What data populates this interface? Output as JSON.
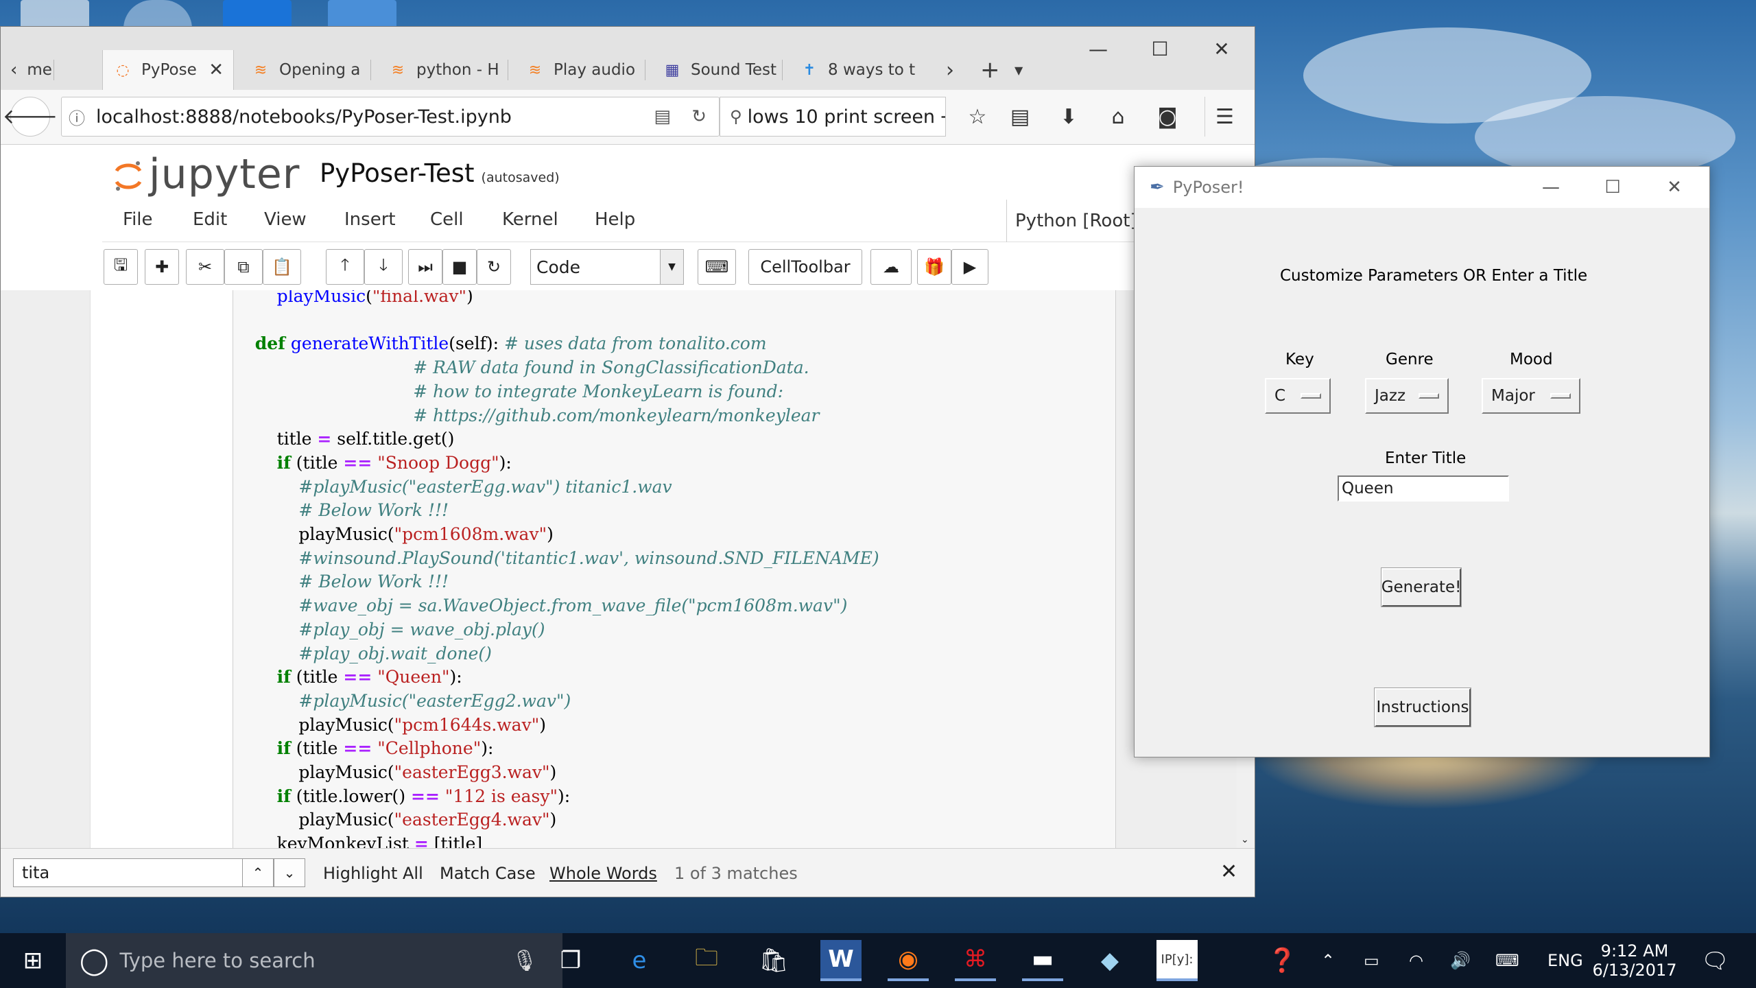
{
  "browser": {
    "tabs": [
      {
        "label": "me",
        "icon": "back-arrow-icon"
      },
      {
        "label": "PyPose",
        "icon": "jupyter-icon",
        "active": true
      },
      {
        "label": "Opening a",
        "icon": "stackoverflow-icon"
      },
      {
        "label": "python - H",
        "icon": "stackoverflow-icon"
      },
      {
        "label": "Play audio",
        "icon": "stackoverflow-icon"
      },
      {
        "label": "Sound Test",
        "icon": "page-icon"
      },
      {
        "label": "8 ways to t",
        "icon": "pin-icon"
      }
    ],
    "url": "localhost:8888/notebooks/PyPoser-Test.ipynb",
    "search_text": "lows 10 print screen"
  },
  "jupyter": {
    "logo": "jupyter",
    "notebook_title": "PyPoser-Test",
    "save_status": "(autosaved)",
    "menu": [
      "File",
      "Edit",
      "View",
      "Insert",
      "Cell",
      "Kernel",
      "Help"
    ],
    "kernel": "Python [Root]",
    "cell_type": "Code",
    "celltoolbar_label": "CellToolbar"
  },
  "code_lines": [
    [
      [
        "",
        "        "
      ],
      [
        "fn",
        "playMusic"
      ],
      [
        "",
        "("
      ],
      [
        "st",
        "\"final.wav\""
      ],
      [
        "",
        ")"
      ]
    ],
    [],
    [
      [
        "",
        "    "
      ],
      [
        "kw",
        "def"
      ],
      [
        "",
        " "
      ],
      [
        "fn",
        "generateWithTitle"
      ],
      [
        "",
        "(self): "
      ],
      [
        "cm",
        "# uses data from tonalito.com"
      ]
    ],
    [
      [
        "",
        "                                 "
      ],
      [
        "cm",
        "# RAW data found in SongClassificationData."
      ]
    ],
    [
      [
        "",
        "                                 "
      ],
      [
        "cm",
        "# how to integrate MonkeyLearn is found:"
      ]
    ],
    [
      [
        "",
        "                                 "
      ],
      [
        "cm",
        "# https://github.com/monkeylearn/monkeylear"
      ]
    ],
    [
      [
        "",
        "        title "
      ],
      [
        "op",
        "="
      ],
      [
        "",
        " self.title.get()"
      ]
    ],
    [
      [
        "",
        "        "
      ],
      [
        "kw",
        "if"
      ],
      [
        "",
        " (title "
      ],
      [
        "op",
        "=="
      ],
      [
        "",
        " "
      ],
      [
        "st",
        "\"Snoop Dogg\""
      ],
      [
        "",
        "):"
      ]
    ],
    [
      [
        "",
        "            "
      ],
      [
        "cm",
        "#playMusic(\"easterEgg.wav\") titanic1.wav"
      ]
    ],
    [
      [
        "",
        "            "
      ],
      [
        "cm",
        "# Below Work !!!"
      ]
    ],
    [
      [
        "",
        "            playMusic("
      ],
      [
        "st",
        "\"pcm1608m.wav\""
      ],
      [
        "",
        ")"
      ]
    ],
    [
      [
        "",
        "            "
      ],
      [
        "cm",
        "#winsound.PlaySound('titantic1.wav', winsound.SND_FILENAME)"
      ]
    ],
    [
      [
        "",
        "            "
      ],
      [
        "cm",
        "# Below Work !!!"
      ]
    ],
    [
      [
        "",
        "            "
      ],
      [
        "cm",
        "#wave_obj = sa.WaveObject.from_wave_file(\"pcm1608m.wav\")"
      ]
    ],
    [
      [
        "",
        "            "
      ],
      [
        "cm",
        "#play_obj = wave_obj.play()"
      ]
    ],
    [
      [
        "",
        "            "
      ],
      [
        "cm",
        "#play_obj.wait_done()"
      ]
    ],
    [
      [
        "",
        "        "
      ],
      [
        "kw",
        "if"
      ],
      [
        "",
        " (title "
      ],
      [
        "op",
        "=="
      ],
      [
        "",
        " "
      ],
      [
        "st",
        "\"Queen\""
      ],
      [
        "",
        "):"
      ]
    ],
    [
      [
        "",
        "            "
      ],
      [
        "cm",
        "#playMusic(\"easterEgg2.wav\")"
      ]
    ],
    [
      [
        "",
        "            playMusic("
      ],
      [
        "st",
        "\"pcm1644s.wav\""
      ],
      [
        "",
        ")"
      ]
    ],
    [
      [
        "",
        "        "
      ],
      [
        "kw",
        "if"
      ],
      [
        "",
        " (title "
      ],
      [
        "op",
        "=="
      ],
      [
        "",
        " "
      ],
      [
        "st",
        "\"Cellphone\""
      ],
      [
        "",
        "):"
      ]
    ],
    [
      [
        "",
        "            playMusic("
      ],
      [
        "st",
        "\"easterEgg3.wav\""
      ],
      [
        "",
        ")"
      ]
    ],
    [
      [
        "",
        "        "
      ],
      [
        "kw",
        "if"
      ],
      [
        "",
        " (title.lower() "
      ],
      [
        "op",
        "=="
      ],
      [
        "",
        " "
      ],
      [
        "st",
        "\"112 is easy\""
      ],
      [
        "",
        "):"
      ]
    ],
    [
      [
        "",
        "            playMusic("
      ],
      [
        "st",
        "\"easterEgg4.wav\""
      ],
      [
        "",
        ")"
      ]
    ],
    [
      [
        "",
        "        keyMonkeyList "
      ],
      [
        "op",
        "="
      ],
      [
        "",
        " [title]"
      ]
    ]
  ],
  "findbar": {
    "query": "tita",
    "highlight_all": "Highlight All",
    "match_case": "Match Case",
    "whole_words": "Whole Words",
    "status": "1 of 3 matches"
  },
  "pyposer": {
    "window_title": "PyPoser!",
    "heading": "Customize Parameters  OR  Enter a Title",
    "key_label": "Key",
    "key_value": "C",
    "genre_label": "Genre",
    "genre_value": "Jazz",
    "mood_label": "Mood",
    "mood_value": "Major",
    "title_label": "Enter Title",
    "title_value": "Queen",
    "generate_button": "Generate!",
    "instructions_button": "Instructions"
  },
  "taskbar": {
    "search_placeholder": "Type here to search",
    "language": "ENG",
    "time": "9:12 AM",
    "date": "6/13/2017",
    "pinned": [
      "task-view-icon",
      "edge-icon",
      "file-explorer-icon",
      "store-icon",
      "word-icon",
      "firefox-icon",
      "acrobat-icon",
      "terminal-icon",
      "app-icon",
      "ipython-icon"
    ]
  },
  "colors": {
    "keyword": "#008000",
    "function": "#0000ff",
    "string": "#ba2121",
    "comment": "#408080",
    "operator": "#aa22ff",
    "jupyter_orange": "#f37726"
  }
}
